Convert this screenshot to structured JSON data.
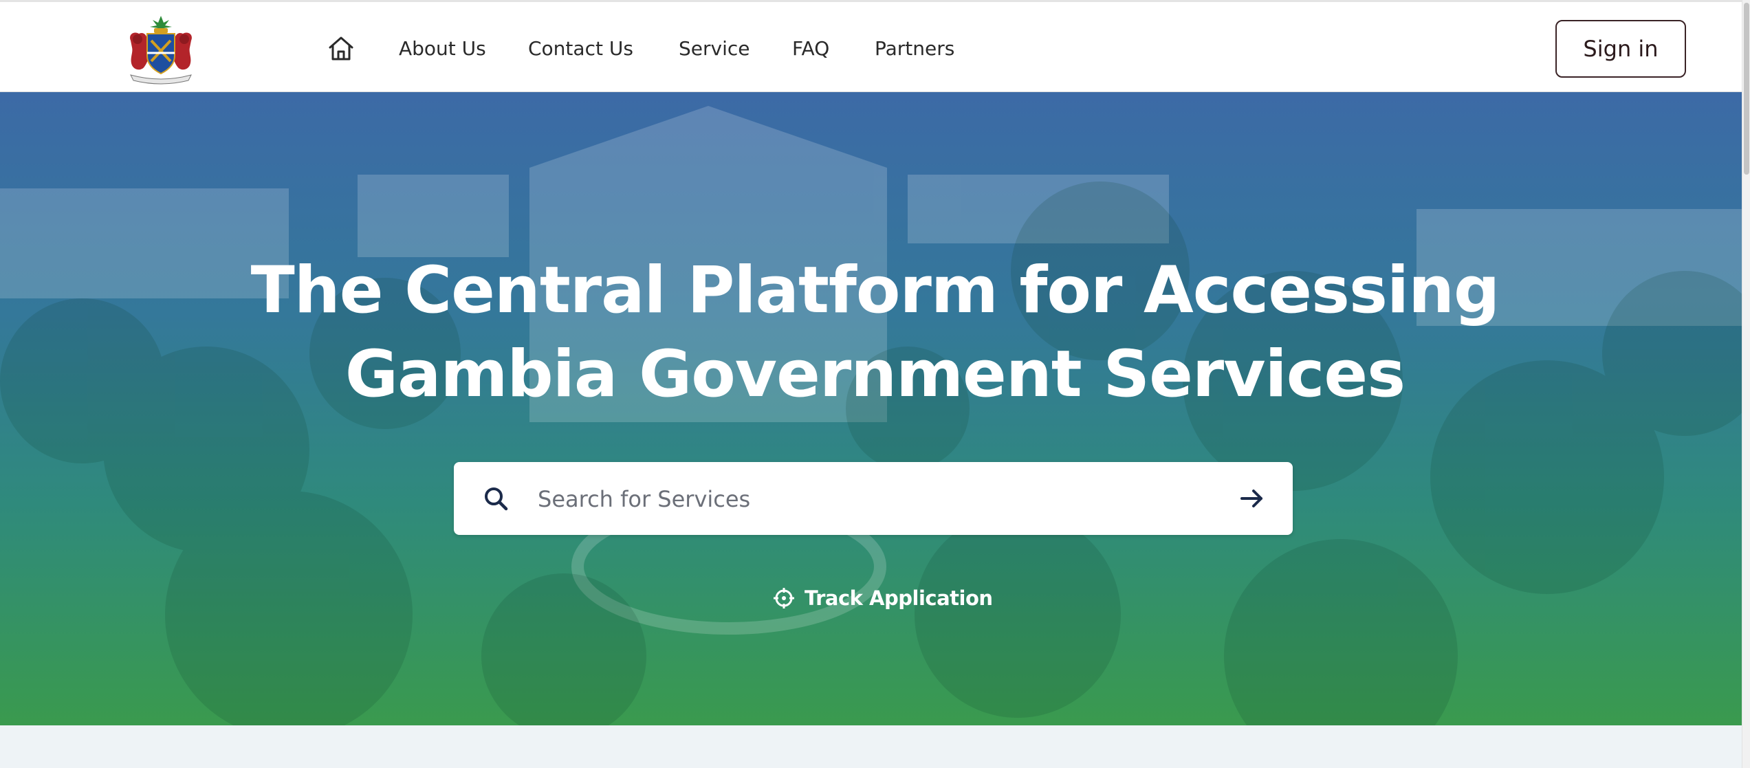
{
  "header": {
    "logo": "gambia-coat-of-arms",
    "nav": {
      "home_icon": "home-icon",
      "items": [
        {
          "label": "About Us"
        },
        {
          "label": "Contact Us"
        },
        {
          "label": "Service"
        },
        {
          "label": "FAQ"
        },
        {
          "label": "Partners"
        }
      ]
    },
    "signin_label": "Sign in"
  },
  "hero": {
    "title_line1": "The Central Platform for Accessing",
    "title_line2": "Gambia Government Services",
    "search": {
      "placeholder": "Search for Services",
      "value": "",
      "icon": "search-icon",
      "submit_icon": "arrow-right-icon"
    },
    "track": {
      "label": "Track Application",
      "icon": "crosshair-icon"
    }
  },
  "colors": {
    "hero_top": "#3c6aa6",
    "hero_bottom": "#3a9a4e",
    "signin_border": "#3a2326",
    "search_icon": "#1b2a4a",
    "bottom_strip": "#eef3f6"
  }
}
